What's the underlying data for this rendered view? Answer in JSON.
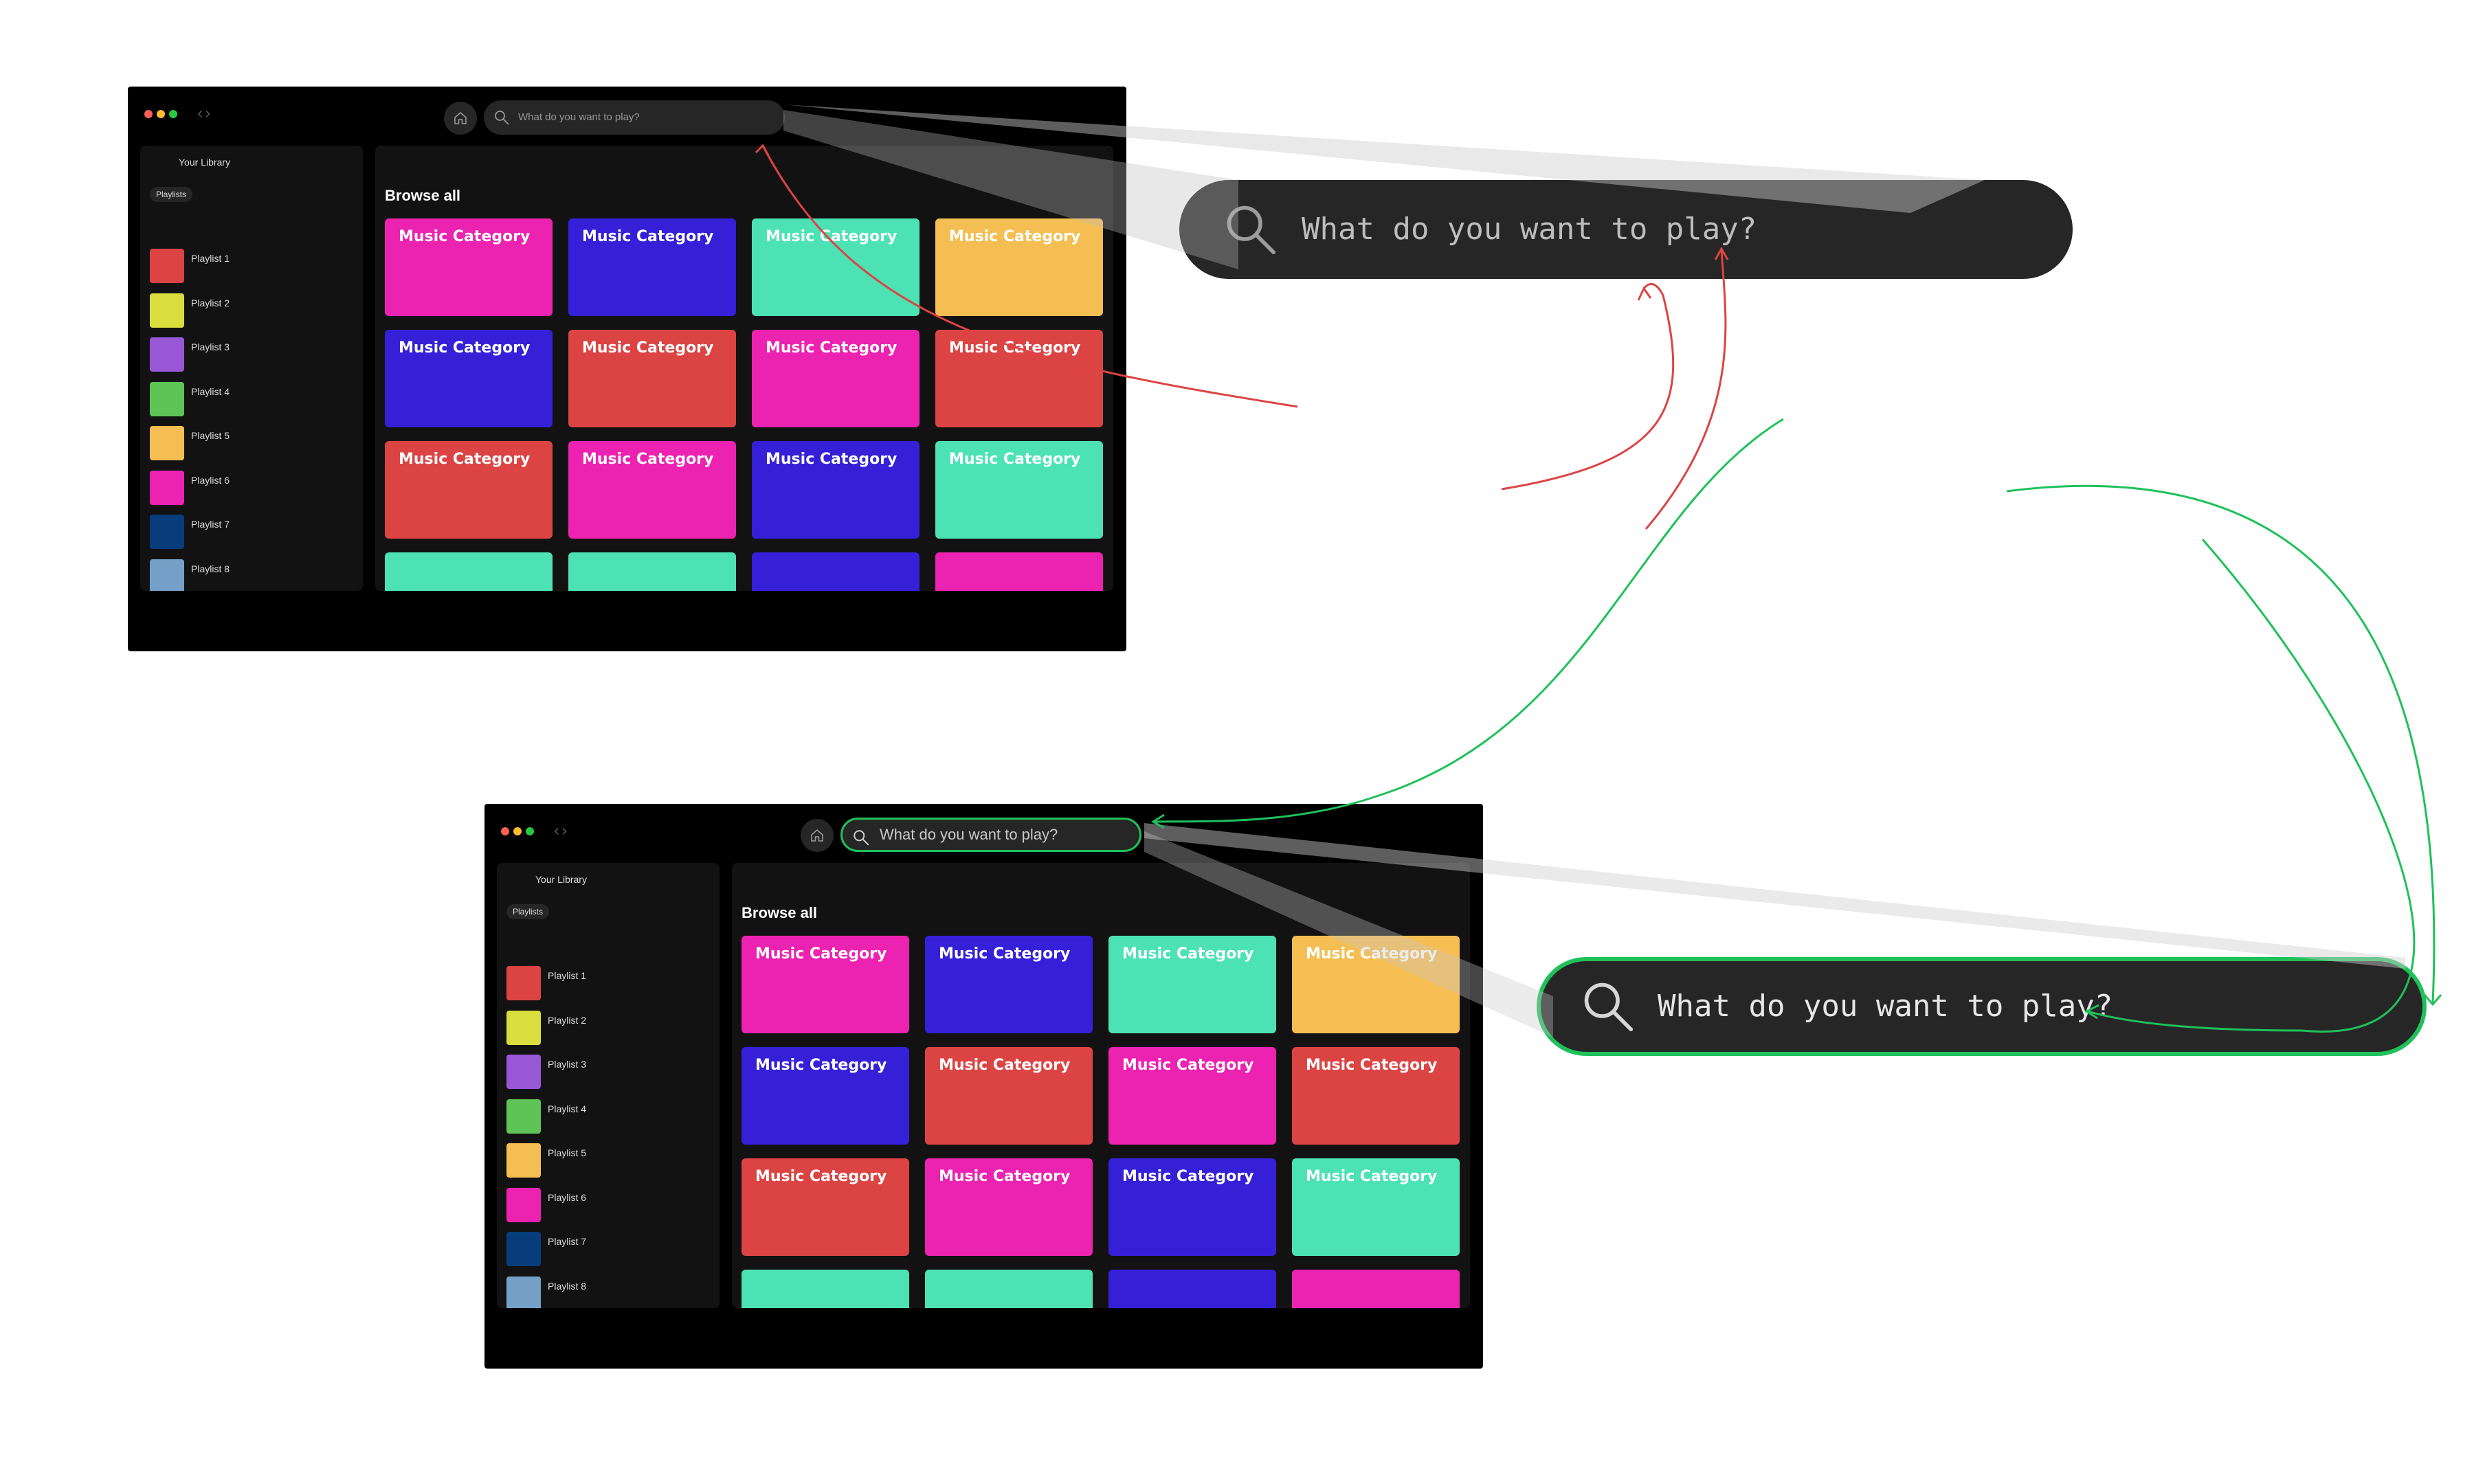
{
  "colors": {
    "red": "#dc4444",
    "green": "#1fc15a",
    "pink": "#ec22b0",
    "indigo": "#3520d8",
    "teal": "#4ce2b4",
    "amber": "#f5be52",
    "yellow": "#d9de3e",
    "purple": "#9858d6",
    "lime": "#5ec455",
    "navy": "#063d7a",
    "steel": "#74a0c7"
  },
  "window_controls": {
    "dots": [
      "#ff5f57",
      "#febc2e",
      "#28c840"
    ],
    "nav_icon": "chevron-left-right-icon"
  },
  "search": {
    "placeholder": "What do you want to play?",
    "icon": "search-icon"
  },
  "home_icon": "home-icon",
  "library": {
    "title": "Your Library",
    "filter_chip": "Playlists",
    "playlists": [
      {
        "name": "Playlist 1",
        "color": "#dc4444"
      },
      {
        "name": "Playlist 2",
        "color": "#d9de3e"
      },
      {
        "name": "Playlist 3",
        "color": "#9858d6"
      },
      {
        "name": "Playlist 4",
        "color": "#5ec455"
      },
      {
        "name": "Playlist 5",
        "color": "#f5be52"
      },
      {
        "name": "Playlist 6",
        "color": "#ec22b0"
      },
      {
        "name": "Playlist 7",
        "color": "#063d7a"
      },
      {
        "name": "Playlist 8",
        "color": "#74a0c7"
      }
    ]
  },
  "browse": {
    "heading": "Browse all",
    "tiles": [
      {
        "label": "Music Category",
        "color": "#ec22b0"
      },
      {
        "label": "Music Category",
        "color": "#3520d8"
      },
      {
        "label": "Music Category",
        "color": "#4ce2b4"
      },
      {
        "label": "Music Category",
        "color": "#f5be52"
      },
      {
        "label": "Music Category",
        "color": "#3520d8"
      },
      {
        "label": "Music Category",
        "color": "#dc4444"
      },
      {
        "label": "Music Category",
        "color": "#ec22b0"
      },
      {
        "label": "Music Category",
        "color": "#dc4444"
      },
      {
        "label": "Music Category",
        "color": "#dc4444"
      },
      {
        "label": "Music Category",
        "color": "#ec22b0"
      },
      {
        "label": "Music Category",
        "color": "#3520d8"
      },
      {
        "label": "Music Category",
        "color": "#4ce2b4"
      },
      {
        "label": "",
        "color": "#4ce2b4"
      },
      {
        "label": "",
        "color": "#4ce2b4"
      },
      {
        "label": "",
        "color": "#3520d8"
      },
      {
        "label": "",
        "color": "#ec22b0"
      }
    ]
  },
  "frames": [
    {
      "state": "default"
    },
    {
      "state": "search-focused"
    }
  ]
}
